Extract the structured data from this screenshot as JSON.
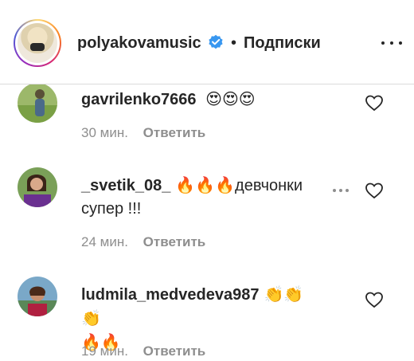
{
  "header": {
    "username": "polyakovamusic",
    "dot": "•",
    "follow_label": "Подписки",
    "verified_color": "#3897f0"
  },
  "comments": [
    {
      "username": "gavrilenko7666",
      "text": "",
      "emoji": "😍😍😍",
      "time": "30 мин.",
      "reply_label": "Ответить"
    },
    {
      "username": "_svetik_08_",
      "text_line1": "девчонки",
      "text_line2": "супер !!!",
      "emoji": "🔥🔥🔥",
      "time": "24 мин.",
      "reply_label": "Ответить"
    },
    {
      "username": "ludmila_medvedeva987",
      "emoji_line1": "👏👏👏",
      "emoji_line2": "🔥🔥",
      "time": "19 мин.",
      "reply_label": "Ответить"
    }
  ],
  "icons": {
    "heart": "heart-icon",
    "more": "more-icon",
    "options": "options-icon",
    "verified": "verified-badge-icon"
  }
}
